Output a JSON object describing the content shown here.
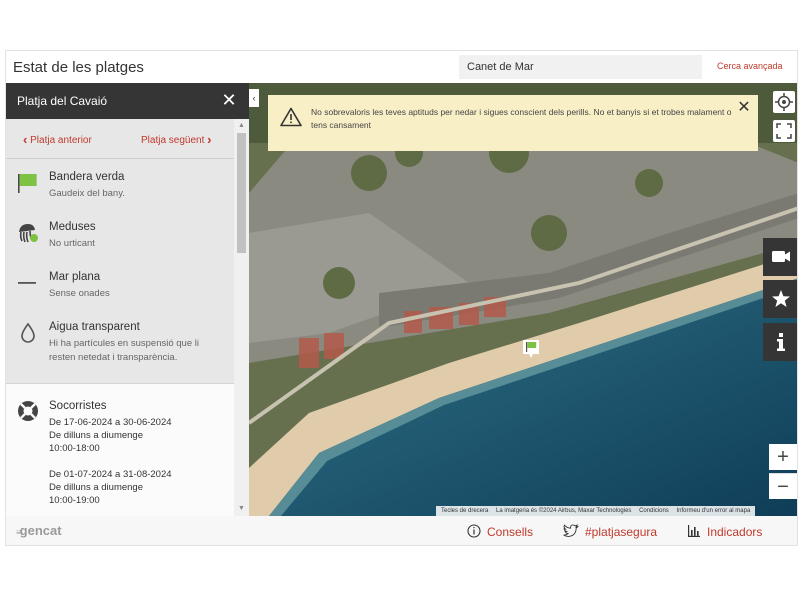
{
  "header": {
    "title": "Estat de les platges",
    "search_value": "Canet de Mar",
    "advanced_search": "Cerca avançada"
  },
  "panel": {
    "title": "Platja del Cavaió",
    "prev": "Platja anterior",
    "next": "Platja següent",
    "items": [
      {
        "icon": "green-flag-icon",
        "title": "Bandera verda",
        "subtitle": "Gaudeix del bany."
      },
      {
        "icon": "jellyfish-icon",
        "title": "Meduses",
        "subtitle": "No urticant"
      },
      {
        "icon": "calm-sea-icon",
        "title": "Mar plana",
        "subtitle": "Sense onades"
      },
      {
        "icon": "water-drop-icon",
        "title": "Aigua transparent",
        "subtitle": "Hi ha partícules en suspensió que li resten netedat i transparència."
      }
    ],
    "lifeguards": {
      "title": "Socorristes",
      "schedules": [
        {
          "dates": "De 17-06-2024 a 30-06-2024",
          "days": "De dilluns a diumenge",
          "hours": "10:00-18:00"
        },
        {
          "dates": "De 01-07-2024 a 31-08-2024",
          "days": "De dilluns a diumenge",
          "hours": "10:00-19:00"
        }
      ]
    }
  },
  "map": {
    "alert": "No sobrevaloris les teves aptituds per nedar i sigues conscient dels perills. No et banyis si et trobes malament o tens cansament",
    "zoom_in": "+",
    "zoom_out": "−",
    "attribution": [
      "Tecles de drecera",
      "La imatgeria és ©2024 Airbus, Maxar Technologies",
      "Condicions",
      "Informeu d'un error al mapa"
    ],
    "flag_color": "#7dc242"
  },
  "footer": {
    "logo": "gencat",
    "links": [
      "Consells",
      "#platjasegura",
      "Indicadors"
    ]
  },
  "colors": {
    "accent": "#c0392b",
    "dark": "#353535",
    "alert_bg": "#f9efc6"
  }
}
